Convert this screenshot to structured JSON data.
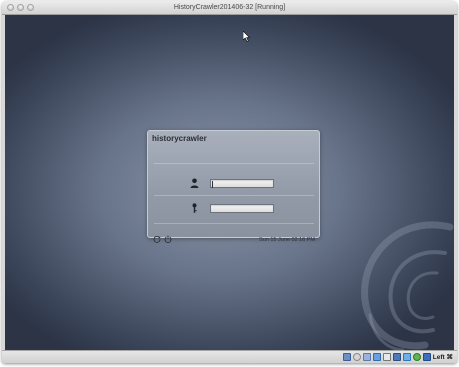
{
  "window": {
    "title": "HistoryCrawler201406-32 [Running]"
  },
  "login": {
    "hostname": "historycrawler",
    "username_value": "",
    "password_value": "",
    "datetime": "Sun 15 June 02:16 PM"
  },
  "icons": {
    "close": "close-dot-icon",
    "minimize": "minimize-dot-icon",
    "zoom": "zoom-dot-icon",
    "user": "user-icon",
    "password": "key-icon",
    "restart": "restart-icon",
    "shutdown": "power-icon",
    "mouse_pointer": "arrow-cursor-icon"
  },
  "statusbar": {
    "icons": [
      "hard-disk-icon",
      "optical-drive-icon",
      "usb-icon",
      "shared-folders-icon",
      "display-icon",
      "network-icon",
      "video-capture-icon",
      "guest-additions-icon",
      "mouse-integration-icon"
    ],
    "host_key": "Left ⌘"
  },
  "colors": {
    "desktop_center": "#8a95a7",
    "desktop_edge": "#2c3446",
    "panel": "#969eab"
  }
}
